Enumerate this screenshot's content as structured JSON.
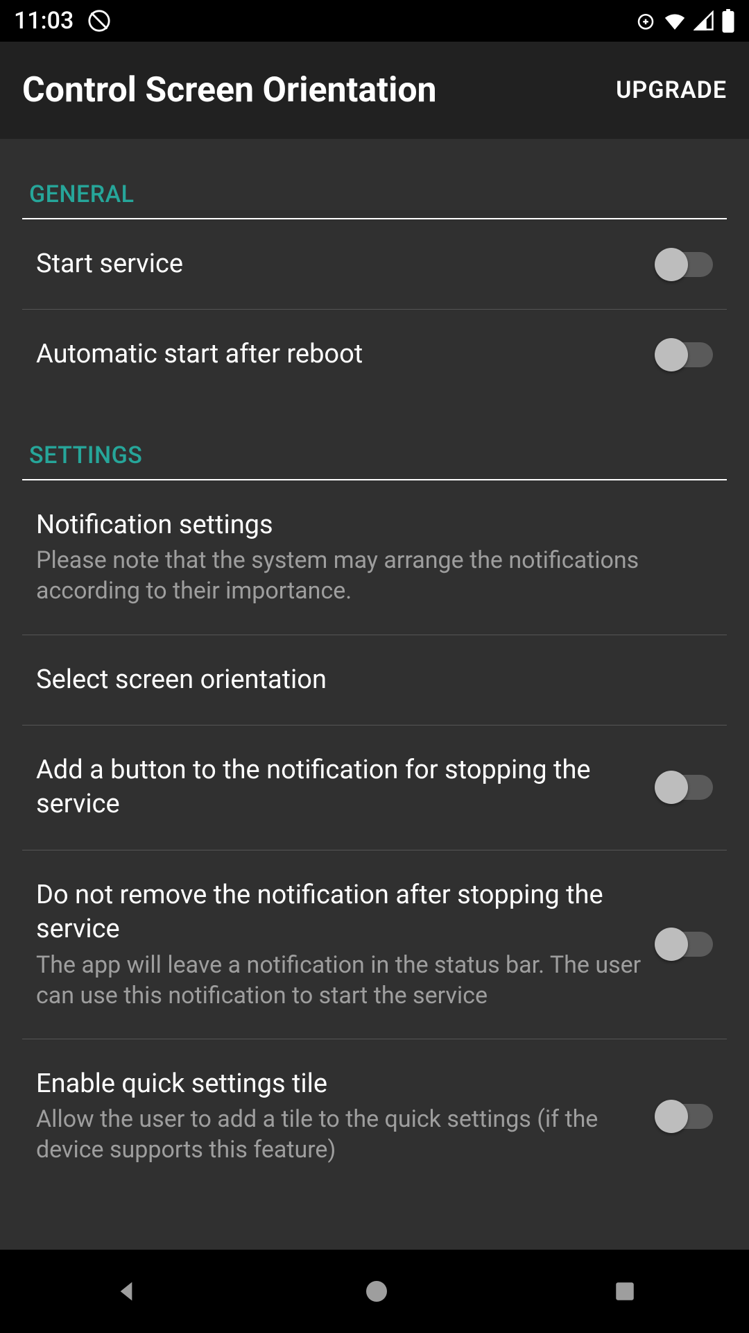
{
  "status": {
    "time": "11:03"
  },
  "appbar": {
    "title": "Control Screen Orientation",
    "upgrade": "UPGRADE"
  },
  "sections": {
    "general": {
      "header": "GENERAL",
      "items": [
        {
          "title": "Start service"
        },
        {
          "title": "Automatic start after reboot"
        }
      ]
    },
    "settings": {
      "header": "SETTINGS",
      "items": [
        {
          "title": "Notification settings",
          "sub": "Please note that the system may arrange the notifications according to their importance."
        },
        {
          "title": "Select screen orientation"
        },
        {
          "title": "Add a button to the notification for stopping the service"
        },
        {
          "title": "Do not remove the notification after stopping the service",
          "sub": "The app will leave a notification in the status bar. The user can use this notification to start the service"
        },
        {
          "title": "Enable quick settings tile",
          "sub": "Allow the user to add a tile to the quick settings (if the device supports this feature)"
        }
      ]
    }
  }
}
